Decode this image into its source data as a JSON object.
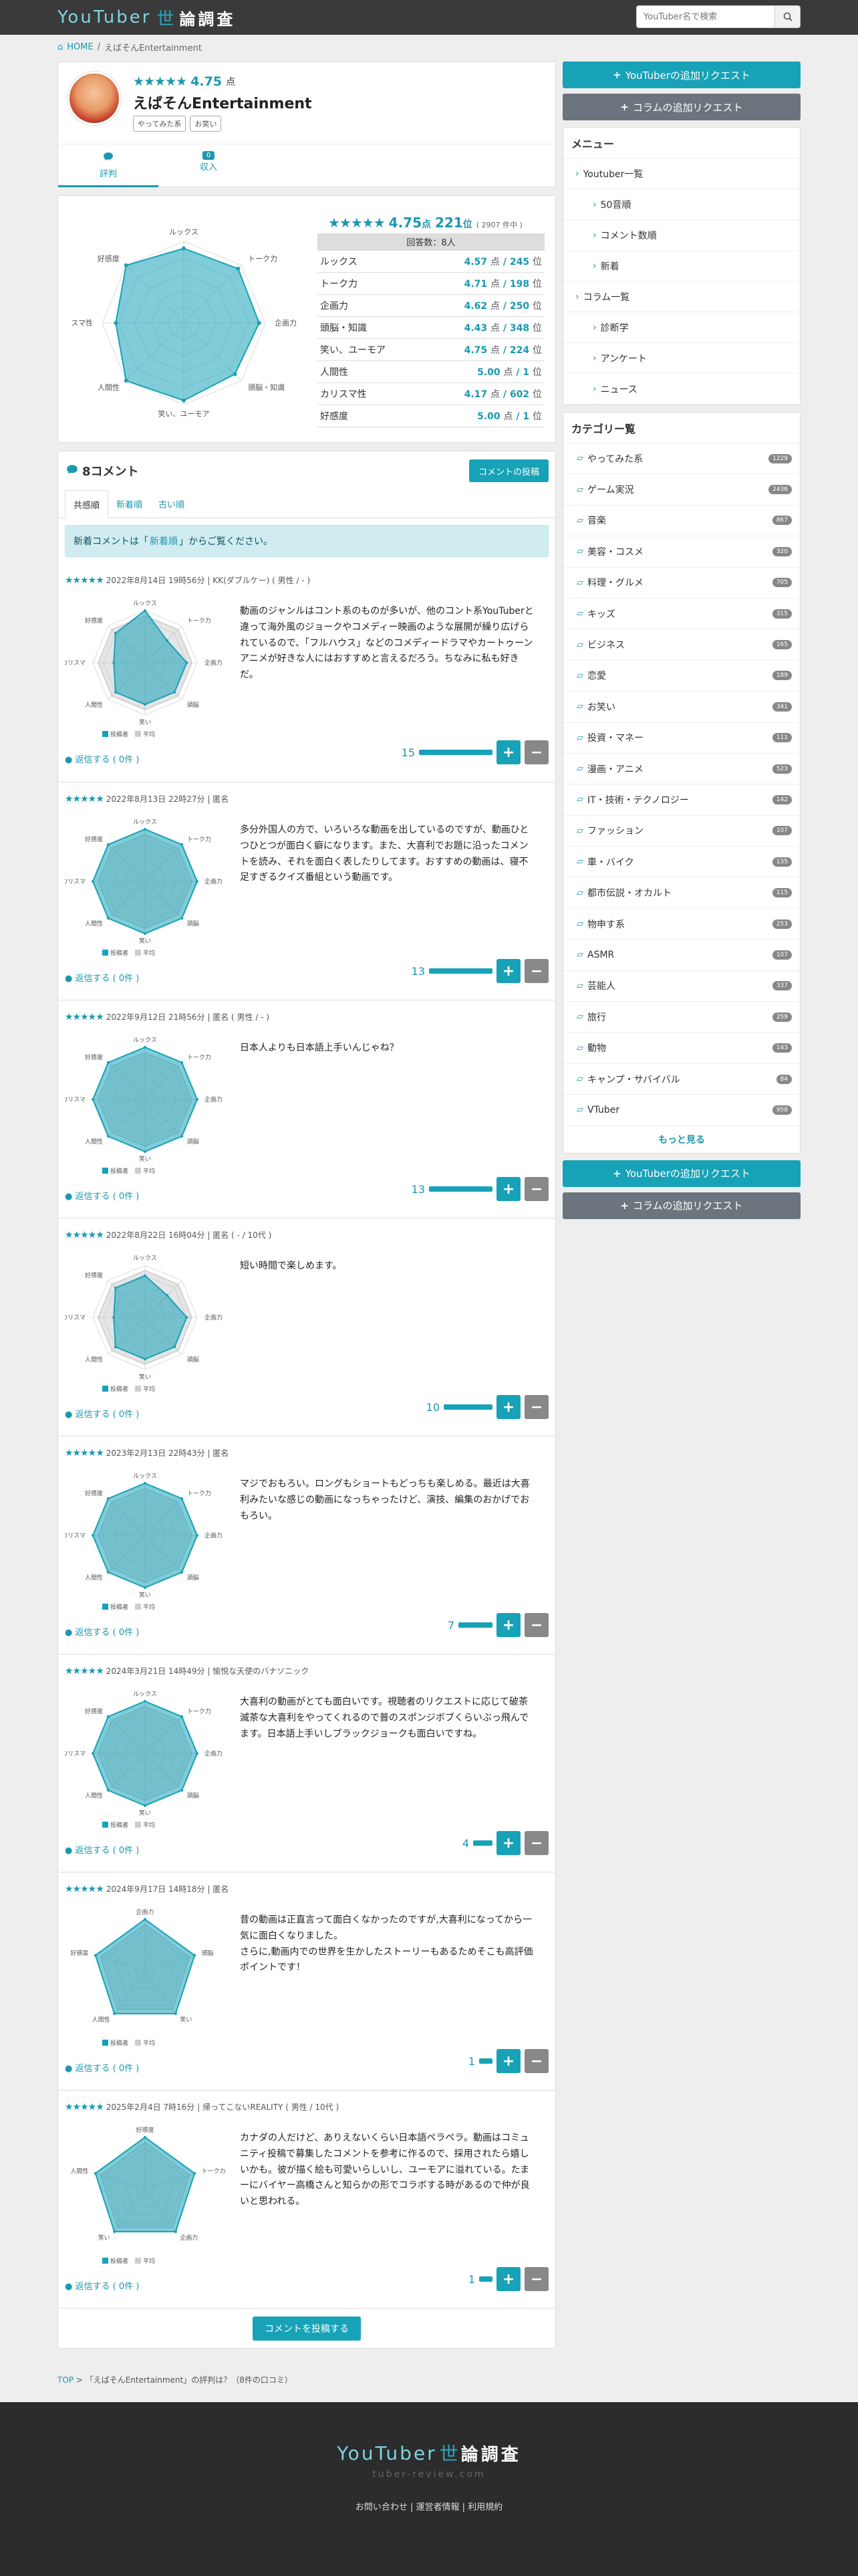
{
  "site": {
    "logo_a": "YouTuber",
    "logo_b": "世",
    "logo_c": "論調査",
    "search_placeholder": "YouTuber名で検索"
  },
  "breadcrumb": {
    "home": "HOME",
    "current": "えばそんEntertainment"
  },
  "profile": {
    "stars": "★★★★★",
    "score": "4.75",
    "score_unit": "点",
    "name": "えばそんEntertainment",
    "tags": [
      "やってみた系",
      "お笑い"
    ],
    "tabs": [
      {
        "label": "評判",
        "icon": "comment-icon"
      },
      {
        "label": "収入",
        "badge": "0"
      }
    ]
  },
  "summary": {
    "stars": "★★★★★",
    "score": "4.75",
    "unit": "点",
    "rank": "221",
    "rank_suffix": "位",
    "rank_total": "( 2907 件中 )",
    "answer_count": "回答数：8人",
    "rows": [
      {
        "label": "ルックス",
        "score": "4.57",
        "rank": "245"
      },
      {
        "label": "トーク力",
        "score": "4.71",
        "rank": "198"
      },
      {
        "label": "企画力",
        "score": "4.62",
        "rank": "250"
      },
      {
        "label": "頭脳・知識",
        "score": "4.43",
        "rank": "348"
      },
      {
        "label": "笑い、ユーモア",
        "score": "4.75",
        "rank": "224"
      },
      {
        "label": "人間性",
        "score": "5.00",
        "rank": "1"
      },
      {
        "label": "カリスマ性",
        "score": "4.17",
        "rank": "602"
      },
      {
        "label": "好感度",
        "score": "5.00",
        "rank": "1"
      }
    ],
    "point_label": "点",
    "rank_label": "位",
    "radar_labels": [
      "ルックス",
      "トーク力",
      "企画力",
      "頭脳・知識",
      "笑い、ユーモア",
      "人間性",
      "カリスマ性",
      "好感度"
    ],
    "radar_values": [
      4.57,
      4.71,
      4.62,
      4.43,
      4.75,
      5.0,
      4.17,
      5.0
    ]
  },
  "comments_section": {
    "count_label": "8コメント",
    "post_button": "コメントの投稿",
    "tabs": [
      "共感順",
      "新着順",
      "古い順"
    ],
    "notice_pre": "新着コメントは「",
    "notice_link": "新着順",
    "notice_post": "」からご覧ください。",
    "bottom_post": "コメントを投稿する",
    "legend_a": "投稿者",
    "legend_b": "平均"
  },
  "comments": [
    {
      "stars": "★★★★★",
      "meta": "2022年8月14日 19時56分 | KK(ダブルケー) ( 男性 / - )",
      "text": "動画のジャンルはコント系のものが多いが、他のコント系YouTuberと違って海外風のジョークやコメディー映画のような展開が繰り広げられているので、「フルハウス」などのコメディードラマやカートゥーンアニメが好きな人にはおすすめと言えるだろう。ちなみに私も好きだ。",
      "reply": "返信する ( 0件 )",
      "votes": "15",
      "labels": [
        "ルックス",
        "トーク力",
        "企画力",
        "頭脳",
        "笑い",
        "人間性",
        "カリスマ",
        "好感度"
      ],
      "values": [
        5,
        3,
        4,
        4,
        4,
        4,
        3,
        4
      ]
    },
    {
      "stars": "★★★★★",
      "meta": "2022年8月13日 22時27分 | 匿名",
      "text": "多分外国人の方で、いろいろな動画を出しているのですが、動画ひとつひとつが面白く癖になります。また、大喜利でお題に沿ったコメントを読み、それを面白く表したりしてます。おすすめの動画は、寝不足すぎるクイズ番組という動画です。",
      "reply": "返信する ( 0件 )",
      "votes": "13",
      "labels": [
        "ルックス",
        "トーク力",
        "企画力",
        "頭脳",
        "笑い",
        "人間性",
        "カリスマ",
        "好感度"
      ],
      "values": [
        5,
        5,
        5,
        5,
        5,
        5,
        5,
        5
      ]
    },
    {
      "stars": "★★★★★",
      "meta": "2022年9月12日 21時56分 | 匿名 ( 男性 / - )",
      "text": "日本人よりも日本語上手いんじゃね？",
      "reply": "返信する ( 0件 )",
      "votes": "13",
      "labels": [
        "ルックス",
        "トーク力",
        "企画力",
        "頭脳",
        "笑い",
        "人間性",
        "カリスマ",
        "好感度"
      ],
      "values": [
        5,
        5,
        5,
        5,
        5,
        5,
        5,
        5
      ]
    },
    {
      "stars": "★★★★★",
      "meta": "2022年8月22日 16時04分 | 匿名 ( - / 10代 )",
      "text": "短い時間で楽しめます。",
      "reply": "返信する ( 0件 )",
      "votes": "10",
      "labels": [
        "ルックス",
        "",
        "企画力",
        "頭脳",
        "笑い",
        "人間性",
        "カリスマ",
        "好感度"
      ],
      "values": [
        4,
        3,
        4,
        4,
        4,
        4,
        3,
        4
      ]
    },
    {
      "stars": "★★★★★",
      "meta": "2023年2月13日 22時43分 | 匿名",
      "text": "マジでおもろい。ロングもショートもどっちも楽しめる。最近は大喜利みたいな感じの動画になっちゃったけど、演技、編集のおかげでおもろい。",
      "reply": "返信する ( 0件 )",
      "votes": "7",
      "labels": [
        "ルックス",
        "トーク力",
        "企画力",
        "頭脳",
        "笑い",
        "人間性",
        "カリスマ",
        "好感度"
      ],
      "values": [
        5,
        5,
        5,
        5,
        5,
        5,
        5,
        5
      ]
    },
    {
      "stars": "★★★★★",
      "meta": "2024年3月21日 14時49分 | 愉悦な天使のバナソニック",
      "text": "大喜利の動画がとても面白いです。視聴者のリクエストに応じて破茶滅茶な大喜利をやってくれるので普のスポンジボブくらいぶっ飛んでます。日本語上手いしブラックジョークも面白いですね。",
      "reply": "返信する ( 0件 )",
      "votes": "4",
      "labels": [
        "ルックス",
        "トーク力",
        "企画力",
        "頭脳",
        "笑い",
        "人間性",
        "カリスマ",
        "好感度"
      ],
      "values": [
        5,
        5,
        5,
        5,
        5,
        5,
        5,
        5
      ]
    },
    {
      "stars": "★★★★★",
      "meta": "2024年9月17日 14時18分 | 匿名",
      "text": "昔の動画は正直言って面白くなかったのですが,大喜利になってから一気に面白くなりました。\nさらに,動画内での世界を生かしたストーリーもあるためそこも高評価ポイントです！",
      "reply": "返信する ( 0件 )",
      "votes": "1",
      "labels": [
        "企画力",
        "頭脳",
        "笑い",
        "人間性",
        "好感度"
      ],
      "values": [
        5,
        5,
        5,
        5,
        5
      ]
    },
    {
      "stars": "★★★★★",
      "meta": "2025年2月4日 7時16分 | 帰ってこないREALITY ( 男性 / 10代 )",
      "text": "カナダの人だけど、ありえないくらい日本語ペラペラ。動画はコミュニティ投稿で募集したコメントを参考に作るので、採用されたら嬉しいかも。彼が描く絵も可愛いらしいし、ユーモアに溢れている。たまーにバイヤー高橋さんと知らかの形でコラボする時があるので仲が良いと思われる。",
      "reply": "返信する ( 0件 )",
      "votes": "1",
      "labels": [
        "好感度",
        "トーク力",
        "企画力",
        "笑い",
        "人間性"
      ],
      "values": [
        5,
        5,
        5,
        5,
        5
      ]
    }
  ],
  "footer_crumb": {
    "top": "TOP",
    "text": "「えばそんEntertainment」の評判は？（8件の口コミ）"
  },
  "side": {
    "add_youtuber": "YouTuberの追加リクエスト",
    "add_column": "コラムの追加リクエスト",
    "menu_title": "メニュー",
    "menu": [
      {
        "label": "Youtuber一覧",
        "level": 0
      },
      {
        "label": "50音順",
        "level": 1
      },
      {
        "label": "コメント数順",
        "level": 1
      },
      {
        "label": "新着",
        "level": 1
      },
      {
        "label": "コラム一覧",
        "level": 0
      },
      {
        "label": "診断学",
        "level": 1
      },
      {
        "label": "アンケート",
        "level": 1
      },
      {
        "label": "ニュース",
        "level": 1
      }
    ],
    "cat_title": "カテゴリー覧",
    "categories": [
      {
        "label": "やってみた系",
        "count": "1229"
      },
      {
        "label": "ゲーム実況",
        "count": "2436"
      },
      {
        "label": "音楽",
        "count": "867"
      },
      {
        "label": "美容・コスメ",
        "count": "320"
      },
      {
        "label": "料理・グルメ",
        "count": "705"
      },
      {
        "label": "キッズ",
        "count": "315"
      },
      {
        "label": "ビジネス",
        "count": "165"
      },
      {
        "label": "恋愛",
        "count": "189"
      },
      {
        "label": "お笑い",
        "count": "341"
      },
      {
        "label": "投資・マネー",
        "count": "111"
      },
      {
        "label": "漫画・アニメ",
        "count": "523"
      },
      {
        "label": "IT・技術・テクノロジー",
        "count": "142"
      },
      {
        "label": "ファッション",
        "count": "107"
      },
      {
        "label": "車・バイク",
        "count": "135"
      },
      {
        "label": "都市伝説・オカルト",
        "count": "115"
      },
      {
        "label": "物申す系",
        "count": "253"
      },
      {
        "label": "ASMR",
        "count": "107"
      },
      {
        "label": "芸能人",
        "count": "337"
      },
      {
        "label": "旅行",
        "count": "259"
      },
      {
        "label": "動物",
        "count": "143"
      },
      {
        "label": "キャンプ・サバイバル",
        "count": "84"
      },
      {
        "label": "VTuber",
        "count": "958"
      }
    ],
    "more": "もっと見る"
  },
  "footer": {
    "logo_a": "YouTuber",
    "logo_b": "世",
    "logo_c": "論調査",
    "sub": "tuber-review.com",
    "links": "お問い合わせ | 運営者情報 | 利用規約"
  },
  "colors": {
    "accent": "#17a2b8",
    "header": "#3a3a3a",
    "footer": "#2c2c2c"
  }
}
